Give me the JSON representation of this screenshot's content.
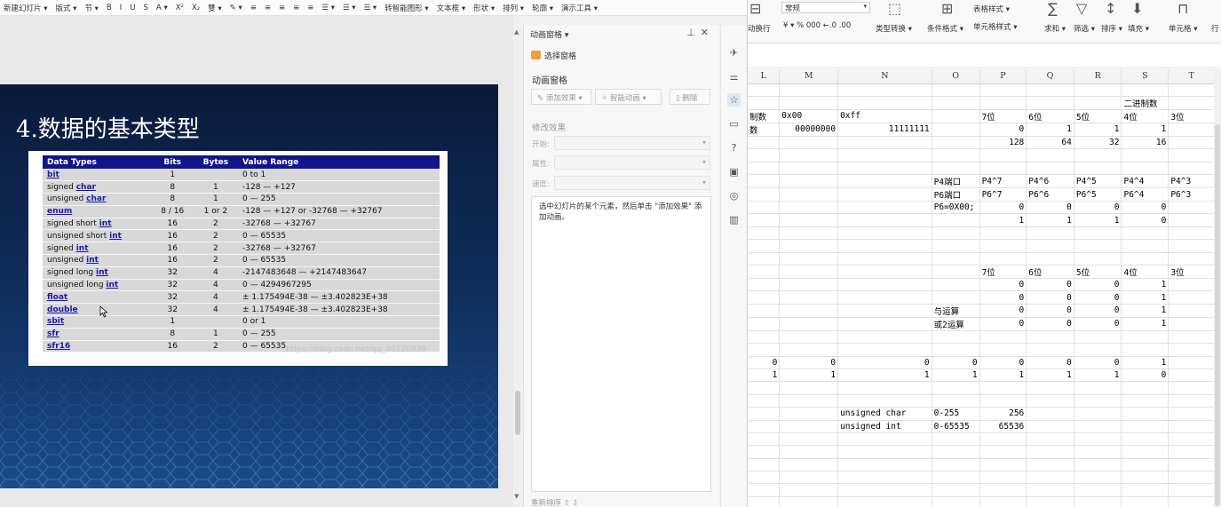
{
  "ppt": {
    "toolbar": [
      "新建幻灯片 ▾",
      "版式 ▾",
      "节 ▾",
      "B",
      "I",
      "U",
      "S",
      "A ▾",
      "X²",
      "X₂",
      "雙 ▾",
      "✎ ▾",
      "≡",
      "≡",
      "≡",
      "≡",
      "≡",
      "☰ ▾",
      "☰ ▾",
      "☰ ▾",
      "转智能图形 ▾",
      "文本框 ▾",
      "形状 ▾",
      "排列 ▾",
      "轮廓 ▾",
      "演示工具 ▾"
    ],
    "slide": {
      "title": "4.数据的基本类型",
      "table": {
        "headers": [
          "Data Types",
          "Bits",
          "Bytes",
          "Value Range"
        ],
        "rows": [
          {
            "pre": "",
            "link": "bit",
            "bits": "1",
            "bytes": "",
            "range": "0 to 1"
          },
          {
            "pre": "signed ",
            "link": "char",
            "bits": "8",
            "bytes": "1",
            "range": "-128 — +127"
          },
          {
            "pre": "unsigned ",
            "link": "char",
            "bits": "8",
            "bytes": "1",
            "range": "0 — 255"
          },
          {
            "pre": "",
            "link": "enum",
            "bits": "8 / 16",
            "bytes": "1 or 2",
            "range": "-128 — +127 or -32768 — +32767"
          },
          {
            "pre": "signed short ",
            "link": "int",
            "bits": "16",
            "bytes": "2",
            "range": "-32768 — +32767"
          },
          {
            "pre": "unsigned short ",
            "link": "int",
            "bits": "16",
            "bytes": "2",
            "range": "0 — 65535"
          },
          {
            "pre": "signed ",
            "link": "int",
            "bits": "16",
            "bytes": "2",
            "range": "-32768 — +32767"
          },
          {
            "pre": "unsigned ",
            "link": "int",
            "bits": "16",
            "bytes": "2",
            "range": "0 — 65535"
          },
          {
            "pre": "signed long ",
            "link": "int",
            "bits": "32",
            "bytes": "4",
            "range": "-2147483648 — +2147483647"
          },
          {
            "pre": "unsigned long ",
            "link": "int",
            "bits": "32",
            "bytes": "4",
            "range": "0 — 4294967295"
          },
          {
            "pre": "",
            "link": "float",
            "bits": "32",
            "bytes": "4",
            "range": "± 1.175494E-38 — ±3.402823E+38"
          },
          {
            "pre": "",
            "link": "double",
            "bits": "32",
            "bytes": "4",
            "range": "± 1.175494E-38 — ±3.402823E+38"
          },
          {
            "pre": "",
            "link": "sbit",
            "bits": "1",
            "bytes": "",
            "range": "0 or 1"
          },
          {
            "pre": "",
            "link": "sfr",
            "bits": "8",
            "bytes": "1",
            "range": "0 — 255"
          },
          {
            "pre": "",
            "link": "sfr16",
            "bits": "16",
            "bytes": "2",
            "range": "0 — 65535"
          }
        ],
        "watermark": "https://blog.csdn.net/qq_40120839"
      }
    },
    "anim_pane": {
      "title": "动画窗格 ▾",
      "select_pane": "选择窗格",
      "section": "动画窗格",
      "add_effect": "添加效果 ▾",
      "smart_anim": "智能动画 ▾",
      "delete": "删除",
      "modify": "修改效果",
      "start_label": "开始:",
      "prop_label": "属性:",
      "speed_label": "速度:",
      "hint": "选中幻灯片的某个元素，然后单击 \"添加效果\" 添加动画。",
      "reorder": "重新排序"
    }
  },
  "excel": {
    "ribbon": {
      "number_format": "常规",
      "wrap": "动换行",
      "currency": "¥ ▾ % 000 ←.0 .00",
      "type_convert": "类型转换 ▾",
      "cond_format": "条件格式 ▾",
      "table_style": "表格样式 ▾",
      "cell_style": "单元格样式 ▾",
      "sum": "求和 ▾",
      "filter": "筛选 ▾",
      "sort": "排序 ▾",
      "fill": "填充 ▾",
      "cell": "单元格 ▾",
      "row": "行"
    },
    "columns": [
      "L",
      "M",
      "N",
      "O",
      "P",
      "Q",
      "R",
      "S",
      "T"
    ],
    "rows": [
      [
        "",
        "",
        "",
        "",
        "",
        "",
        "",
        "",
        ""
      ],
      [
        "",
        "",
        "",
        "",
        "",
        "",
        "",
        "二进制数",
        ""
      ],
      [
        "制数",
        "0x00",
        "0xff",
        "",
        "7位",
        "6位",
        "5位",
        "4位",
        "3位"
      ],
      [
        "数",
        "00000000",
        "11111111",
        "",
        "0",
        "1",
        "1",
        "1",
        ""
      ],
      [
        "",
        "",
        "",
        "",
        "128",
        "64",
        "32",
        "16",
        ""
      ],
      [
        "",
        "",
        "",
        "",
        "",
        "",
        "",
        "",
        ""
      ],
      [
        "",
        "",
        "",
        "",
        "",
        "",
        "",
        "",
        ""
      ],
      [
        "",
        "",
        "",
        "P4端口",
        "P4^7",
        "P4^6",
        "P4^5",
        "P4^4",
        "P4^3"
      ],
      [
        "",
        "",
        "",
        "P6端口",
        "P6^7",
        "P6^6",
        "P6^5",
        "P6^4",
        "P6^3"
      ],
      [
        "",
        "",
        "",
        "P6=0X00;",
        "0",
        "0",
        "0",
        "0",
        ""
      ],
      [
        "",
        "",
        "",
        "",
        "1",
        "1",
        "1",
        "0",
        ""
      ],
      [
        "",
        "",
        "",
        "",
        "",
        "",
        "",
        "",
        ""
      ],
      [
        "",
        "",
        "",
        "",
        "",
        "",
        "",
        "",
        ""
      ],
      [
        "",
        "",
        "",
        "",
        "",
        "",
        "",
        "",
        ""
      ],
      [
        "",
        "",
        "",
        "",
        "7位",
        "6位",
        "5位",
        "4位",
        "3位"
      ],
      [
        "",
        "",
        "",
        "",
        "0",
        "0",
        "0",
        "1",
        ""
      ],
      [
        "",
        "",
        "",
        "",
        "0",
        "0",
        "0",
        "1",
        ""
      ],
      [
        "",
        "",
        "",
        "与运算",
        "0",
        "0",
        "0",
        "1",
        ""
      ],
      [
        "",
        "",
        "",
        "或2运算",
        "0",
        "0",
        "0",
        "1",
        ""
      ],
      [
        "",
        "",
        "",
        "",
        "",
        "",
        "",
        "",
        ""
      ],
      [
        "",
        "",
        "",
        "",
        "",
        "",
        "",
        "",
        ""
      ],
      [
        "0",
        "0",
        "0",
        "0",
        "0",
        "0",
        "0",
        "1",
        ""
      ],
      [
        "1",
        "1",
        "1",
        "1",
        "1",
        "1",
        "1",
        "0",
        ""
      ],
      [
        "",
        "",
        "",
        "",
        "",
        "",
        "",
        "",
        ""
      ],
      [
        "",
        "",
        "",
        "",
        "",
        "",
        "",
        "",
        ""
      ],
      [
        "",
        "",
        "unsigned char",
        "0-255",
        "256",
        "",
        "",
        "",
        ""
      ],
      [
        "",
        "",
        "unsigned int",
        "0-65535",
        "65536",
        "",
        "",
        "",
        ""
      ],
      [
        "",
        "",
        "",
        "",
        "",
        "",
        "",
        "",
        ""
      ],
      [
        "",
        "",
        "",
        "",
        "",
        "",
        "",
        "",
        ""
      ],
      [
        "",
        "",
        "",
        "",
        "",
        "",
        "",
        "",
        ""
      ],
      [
        "",
        "",
        "",
        "",
        "",
        "",
        "",
        "",
        ""
      ],
      [
        "",
        "",
        "",
        "",
        "",
        "",
        "",
        "",
        ""
      ],
      [
        "",
        "",
        "",
        "",
        "",
        "",
        "",
        "",
        ""
      ]
    ]
  }
}
